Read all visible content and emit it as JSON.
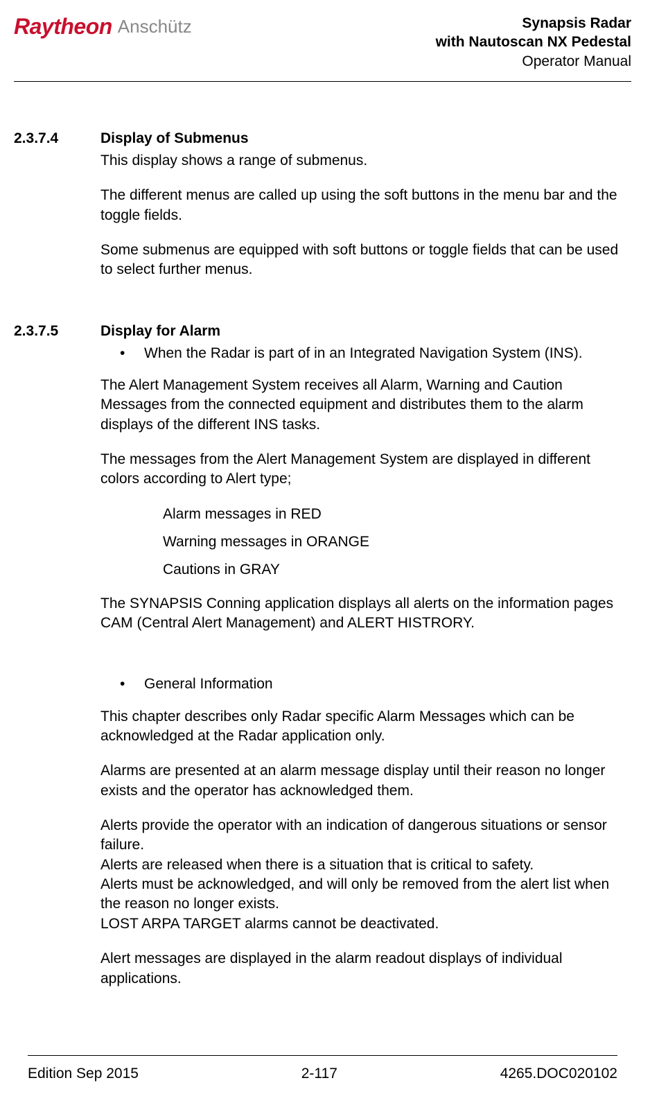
{
  "header": {
    "logo_raytheon": "Raytheon",
    "logo_anschutz": "Anschütz",
    "title1": "Synapsis Radar",
    "title2": "with Nautoscan NX Pedestal",
    "title3": "Operator Manual"
  },
  "sections": [
    {
      "num": "2.3.7.4",
      "title": "Display of Submenus",
      "p1": "This display shows a range of submenus.",
      "p2": "The different menus are called up using the soft buttons in the menu bar and the toggle fields.",
      "p3": "Some submenus are equipped with soft buttons or toggle fields that can be used to select further menus."
    },
    {
      "num": "2.3.7.5",
      "title": "Display for Alarm",
      "b1": "When the Radar is part of in an Integrated Navigation System (INS).",
      "p1": "The Alert Management System receives all Alarm, Warning and Caution Messages from the connected equipment and distributes them to the alarm displays of the different INS tasks.",
      "p2": "The messages from the Alert Management System are displayed in different colors according to Alert type;",
      "c1": "Alarm messages in RED",
      "c2": "Warning messages in ORANGE",
      "c3": "Cautions in GRAY",
      "p3": "The SYNAPSIS Conning application displays all alerts on the information pages CAM (Central Alert Management) and ALERT HISTRORY.",
      "b2": "General Information",
      "p4": "This chapter describes only Radar specific Alarm Messages which can be acknowledged at the Radar application only.",
      "p5": "Alarms are presented at an alarm message display until their reason no longer exists and the operator has acknowledged them.",
      "p6a": "Alerts provide the operator with an indication of dangerous situations or sensor failure.",
      "p6b": "Alerts are released when there is a situation that is critical to safety.",
      "p6c": "Alerts must be acknowledged, and will only be removed from the alert list when the reason no longer exists.",
      "p6d": "LOST ARPA TARGET alarms cannot be deactivated.",
      "p7": "Alert messages are displayed in the alarm readout displays of individual applications."
    }
  ],
  "footer": {
    "edition": "Edition Sep 2015",
    "page": "2-117",
    "docnum": "4265.DOC020102"
  },
  "bullet": "•"
}
